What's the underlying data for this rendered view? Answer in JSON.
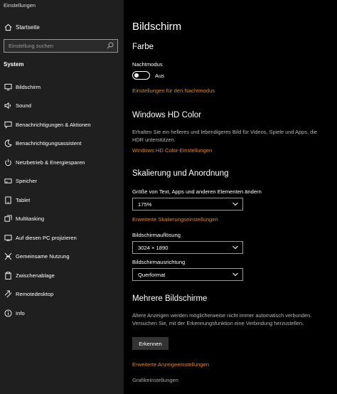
{
  "app": {
    "title": "Einstellungen"
  },
  "sidebar": {
    "home_label": "Startseite",
    "search_placeholder": "Einstellung suchen",
    "section_label": "System",
    "items": [
      {
        "label": "Bildschirm",
        "icon": "monitor-icon"
      },
      {
        "label": "Sound",
        "icon": "speaker-icon"
      },
      {
        "label": "Benachrichtigungen & Aktionen",
        "icon": "message-icon"
      },
      {
        "label": "Benachrichtigungsassistent",
        "icon": "moon-icon"
      },
      {
        "label": "Netzbetrieb & Energiesparen",
        "icon": "power-icon"
      },
      {
        "label": "Speicher",
        "icon": "storage-icon"
      },
      {
        "label": "Tablet",
        "icon": "tablet-icon"
      },
      {
        "label": "Multitasking",
        "icon": "multitasking-icon"
      },
      {
        "label": "Auf diesen PC projizieren",
        "icon": "project-icon"
      },
      {
        "label": "Gemeinsame Nutzung",
        "icon": "share-icon"
      },
      {
        "label": "Zwischenablage",
        "icon": "clipboard-icon"
      },
      {
        "label": "Remotedesktop",
        "icon": "remote-icon"
      },
      {
        "label": "Info",
        "icon": "info-icon"
      }
    ]
  },
  "main": {
    "title": "Bildschirm",
    "farbe": {
      "heading": "Farbe",
      "night_label": "Nachtmodus",
      "toggle_state": "Aus",
      "night_link": "Einstellungen für den Nachtmodus"
    },
    "hd": {
      "heading": "Windows HD Color",
      "description": "Erhalten Sie ein helleres und lebendigeres Bild für Videos, Spiele und Apps, die HDR unterstützen.",
      "link": "Windows HD Color-Einstellungen"
    },
    "scale": {
      "heading": "Skalierung und Anordnung",
      "size_label": "Größe von Text, Apps und anderen Elementen ändern",
      "size_value": "175%",
      "advanced_link": "Erweiterte Skalierungseinstellungen",
      "resolution_label": "Bildschirmauflösung",
      "resolution_value": "3024 × 1890",
      "orientation_label": "Bildschirmausrichtung",
      "orientation_value": "Querformat"
    },
    "multi": {
      "heading": "Mehrere Bildschirme",
      "description": "Ältere Anzeigen werden möglicherweise nicht immer automatisch verbunden. Versuchen Sie, mit der Erkennungsfunktion eine Verbindung herzustellen.",
      "detect_button": "Erkennen",
      "advanced_link": "Erweiterte Anzeigeeinstellungen",
      "graphics_link": "Grafikeinstellungen"
    }
  }
}
